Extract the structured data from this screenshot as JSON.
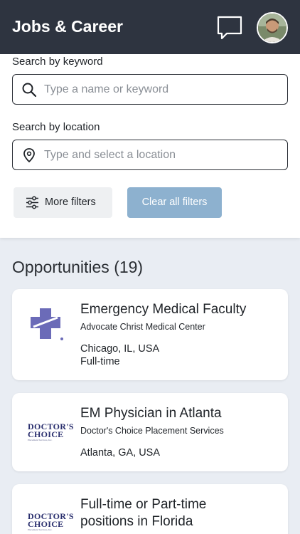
{
  "header": {
    "title": "Jobs & Career",
    "icons": {
      "messages": "chat-bubble-icon",
      "avatar": "user-avatar"
    }
  },
  "search": {
    "keyword_label": "Search by keyword",
    "keyword_placeholder": "Type a name or keyword",
    "location_label": "Search by location",
    "location_placeholder": "Type and select a location",
    "more_filters_label": "More filters",
    "clear_filters_label": "Clear all filters"
  },
  "opportunities": {
    "heading": "Opportunities (19)",
    "items": [
      {
        "title": "Emergency Medical Faculty",
        "company": "Advocate Christ Medical Center",
        "location": "Chicago, IL, USA",
        "type": "Full-time",
        "logo": "advocate-cross-logo"
      },
      {
        "title": "EM Physician in Atlanta",
        "company": "Doctor's Choice Placement Services",
        "location": "Atlanta, GA, USA",
        "type": "",
        "logo": "doctors-choice-logo"
      },
      {
        "title_line1": "Full-time or Part-time",
        "title_line2": "positions in Florida",
        "logo": "doctors-choice-logo"
      }
    ]
  },
  "logos": {
    "doctors_choice_line1": "DOCTOR'S",
    "doctors_choice_line2": "CHOICE",
    "doctors_choice_line3": "Placement Services, Inc."
  },
  "colors": {
    "header_bg": "#2e3440",
    "clear_button": "#8db1cf",
    "page_bg": "#e9edf3",
    "advocate_purple": "#6b6bb8"
  }
}
